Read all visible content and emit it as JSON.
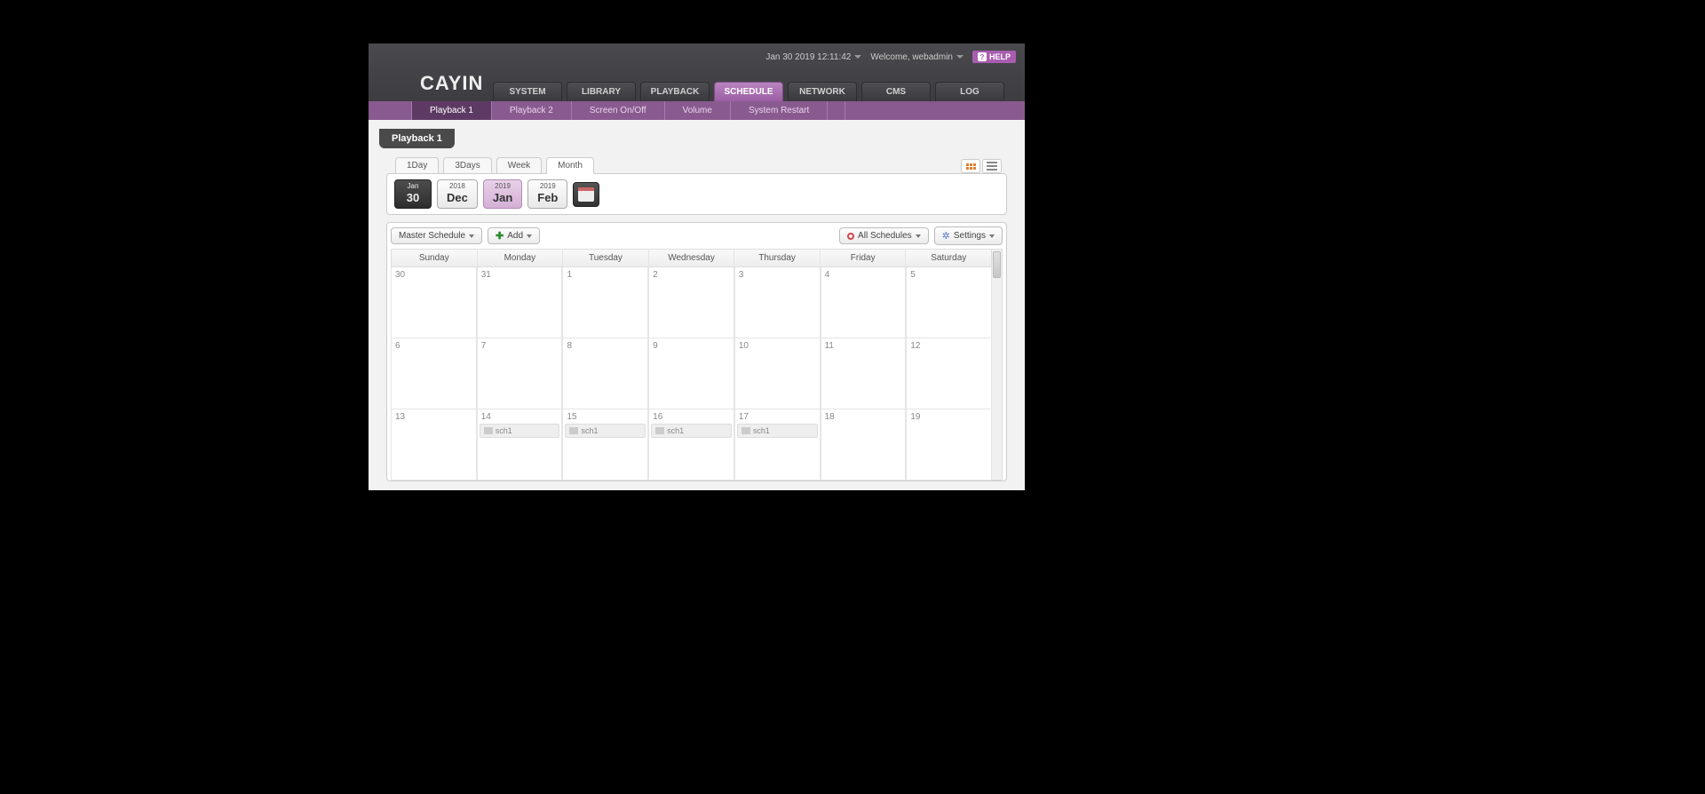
{
  "topbar": {
    "datetime": "Jan 30 2019 12:11:42",
    "welcome": "Welcome, webadmin",
    "help": "HELP"
  },
  "logo": "CAYIN",
  "nav": [
    "SYSTEM",
    "LIBRARY",
    "PLAYBACK",
    "SCHEDULE",
    "NETWORK",
    "CMS",
    "LOG"
  ],
  "nav_active": 3,
  "subnav": [
    "Playback 1",
    "Playback 2",
    "Screen On/Off",
    "Volume",
    "System Restart"
  ],
  "subnav_active": 0,
  "page_title": "Playback 1",
  "view_tabs": [
    "1Day",
    "3Days",
    "Week",
    "Month"
  ],
  "view_tab_active": 3,
  "date_nav": [
    {
      "top": "Jan",
      "bot": "30",
      "style": "dark"
    },
    {
      "top": "2018",
      "bot": "Dec",
      "style": "light"
    },
    {
      "top": "2019",
      "bot": "Jan",
      "style": "pink"
    },
    {
      "top": "2019",
      "bot": "Feb",
      "style": "light"
    }
  ],
  "toolbar": {
    "master": "Master Schedule",
    "add": "Add",
    "all": "All Schedules",
    "settings": "Settings"
  },
  "days": [
    "Sunday",
    "Monday",
    "Tuesday",
    "Wednesday",
    "Thursday",
    "Friday",
    "Saturday"
  ],
  "rows": [
    [
      {
        "n": "30",
        "dim": true
      },
      {
        "n": "31",
        "dim": true
      },
      {
        "n": "1"
      },
      {
        "n": "2"
      },
      {
        "n": "3"
      },
      {
        "n": "4"
      },
      {
        "n": "5"
      }
    ],
    [
      {
        "n": "6"
      },
      {
        "n": "7"
      },
      {
        "n": "8"
      },
      {
        "n": "9"
      },
      {
        "n": "10"
      },
      {
        "n": "11"
      },
      {
        "n": "12"
      }
    ],
    [
      {
        "n": "13"
      },
      {
        "n": "14",
        "ev": "sch1"
      },
      {
        "n": "15",
        "ev": "sch1"
      },
      {
        "n": "16",
        "ev": "sch1"
      },
      {
        "n": "17",
        "ev": "sch1"
      },
      {
        "n": "18"
      },
      {
        "n": "19"
      }
    ]
  ]
}
